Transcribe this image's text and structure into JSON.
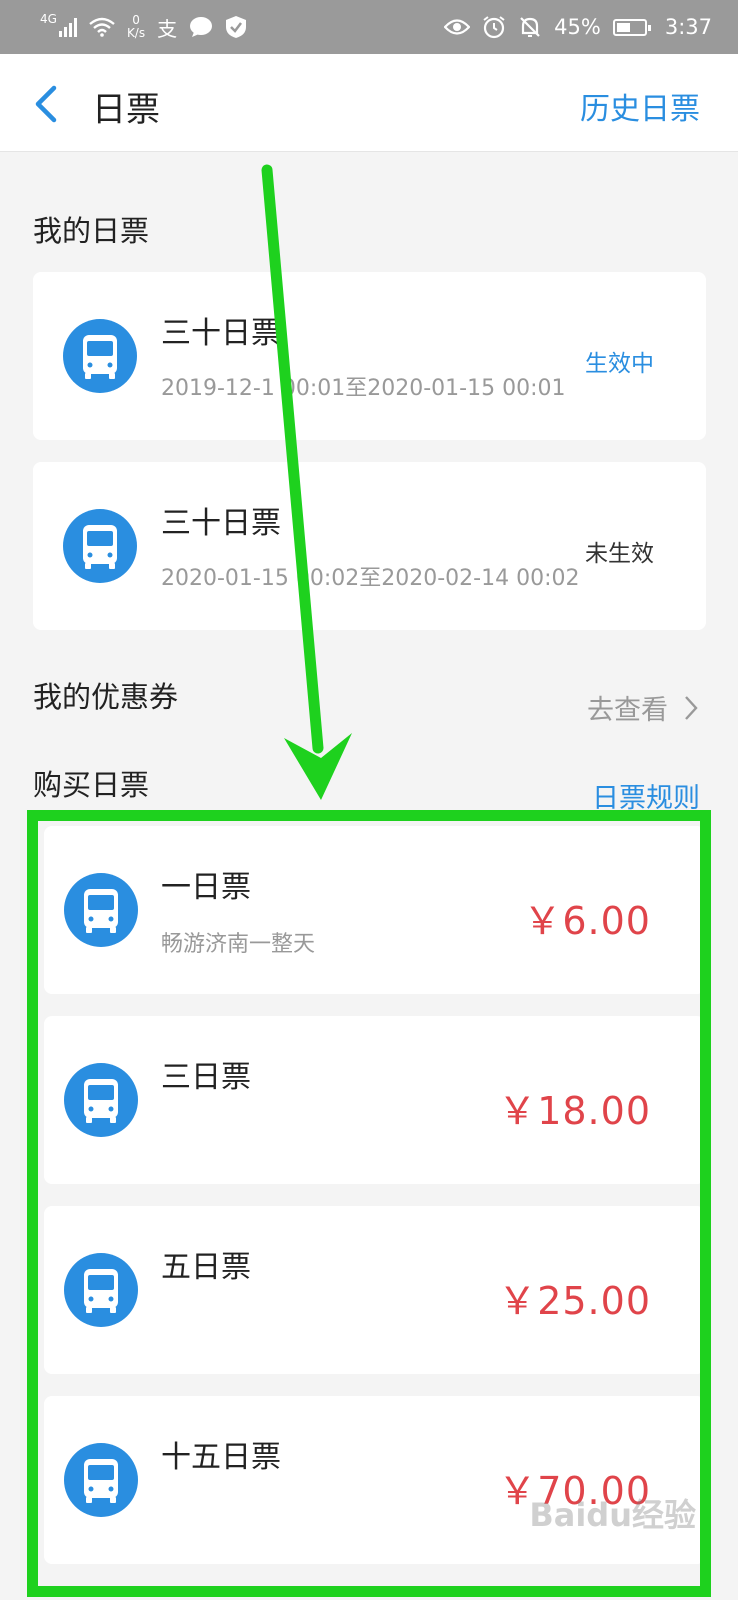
{
  "status_bar": {
    "network": "4G",
    "speed_value": "0",
    "speed_unit": "K/s",
    "alipay_glyph": "支",
    "battery": "45%",
    "time": "3:37",
    "icons": [
      "signal-icon",
      "wifi-icon",
      "chat-icon",
      "shield-icon",
      "eye-icon",
      "alarm-icon",
      "bell-off-icon",
      "battery-icon"
    ]
  },
  "header": {
    "title": "日票",
    "history_label": "历史日票"
  },
  "my_tickets": {
    "title": "我的日票",
    "items": [
      {
        "name": "三十日票",
        "dates": "2019-12-1  00:01至2020-01-15 00:01",
        "status": "生效中",
        "status_color": "#2a8ee0"
      },
      {
        "name": "三十日票",
        "dates": "2020-01-15 00:02至2020-02-14 00:02",
        "status": "未生效",
        "status_color": "#333333"
      }
    ]
  },
  "coupons": {
    "title": "我的优惠券",
    "link_label": "去查看"
  },
  "buy": {
    "title": "购买日票",
    "rules_label": "日票规则",
    "items": [
      {
        "name": "一日票",
        "subtitle": "畅游济南一整天",
        "price": "￥6.00"
      },
      {
        "name": "三日票",
        "subtitle": "",
        "price": "￥18.00"
      },
      {
        "name": "五日票",
        "subtitle": "",
        "price": "￥25.00"
      },
      {
        "name": "十五日票",
        "subtitle": "",
        "price": "￥70.00"
      }
    ]
  },
  "watermark": "Baidu经验",
  "colors": {
    "accent": "#2a8ee0",
    "price": "#e0444a",
    "highlight": "#1ed11e"
  }
}
